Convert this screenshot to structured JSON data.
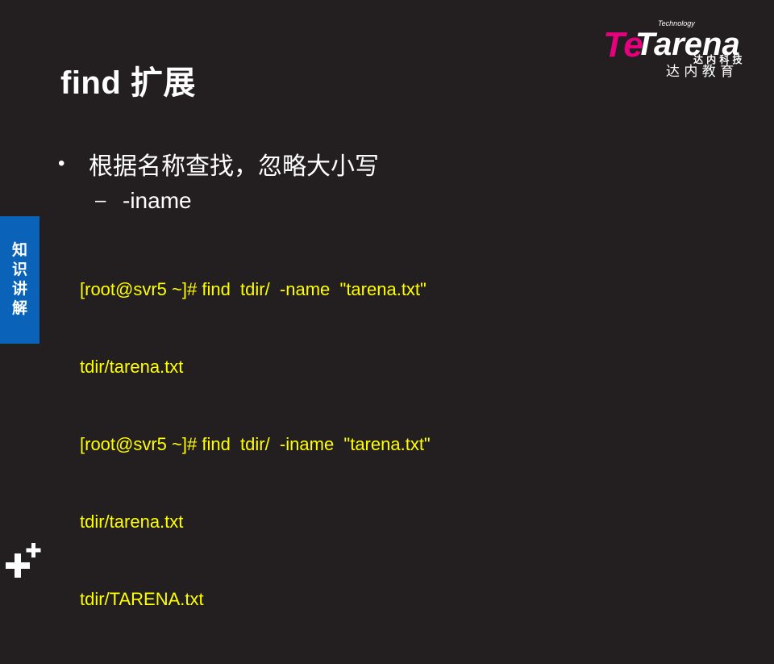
{
  "slide": {
    "title": "find 扩展",
    "bullet": {
      "marker": "•",
      "text": "根据名称查找，忽略大小写"
    },
    "sub_bullet": {
      "marker": "–",
      "text": "-iname"
    },
    "code_lines": [
      "[root@svr5 ~]# find  tdir/  -name  \"tarena.txt\"",
      "tdir/tarena.txt",
      "[root@svr5 ~]# find  tdir/  -iname  \"tarena.txt\"",
      "tdir/tarena.txt",
      "tdir/TARENA.txt"
    ]
  },
  "side_tab": {
    "chars": [
      "知",
      "识",
      "讲",
      "解"
    ]
  },
  "logo": {
    "technology": "Technology",
    "brand": "Tarena",
    "te": "Te",
    "keji": "达 内 科 技",
    "jiaoyu": "达 内 教 育"
  },
  "colors": {
    "background": "#231f20",
    "code_text": "#ffff00",
    "side_tab": "#0a63b8",
    "logo_pink": "#e5007e"
  }
}
